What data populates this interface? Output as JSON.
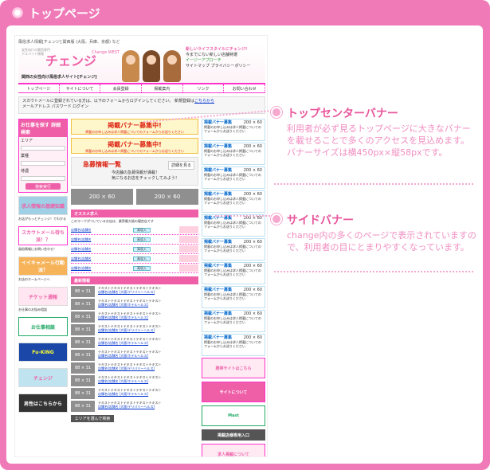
{
  "page_title": "トップページ",
  "shot": {
    "tagline": "風俗求人情報[チェンジ] 関西版 (大阪、兵庫、京都) など",
    "logo_sub": "女性向けの関西専門アルバイト情報",
    "logo": "チェンジ",
    "logo_west": "Change WEST",
    "logo_desc": "関西の女性向け風俗求人サイト[チェンジ]",
    "hdr_line1": "新しいライフスタイルにチェンジ!",
    "hdr_line2": "今までにない新しい店舗特選",
    "hdr_line3": "イージーアプローチ",
    "hdr_links": "サイトマップ  プライバシーポリシー",
    "nav": [
      "トップページ",
      "サイトについて",
      "会員登録",
      "掲載案内",
      "リンク",
      "お問い合わせ"
    ],
    "login_text": "スカウトメールに登録されている方は、以下のフォームからログインしてください。 新規登録は",
    "login_link": "こちらから",
    "login_fields": "メールアドレス  パスワード  ログイン",
    "left": {
      "search_title": "お仕事を探す 詳細検索",
      "search_labels": [
        "エリア",
        "業種",
        "待遇"
      ],
      "search_button": "検索実行",
      "banner1": "求人情報の基礎知識",
      "note1": "お店がもっとチェンジ！でわかる",
      "banner2": "スカウトメール待ち派！？",
      "note2": "風俗情報にお問い合わせ！",
      "banner3": "イイキャメール行動派？",
      "note3": "お店のホームページへ",
      "banner4": "チケット通報",
      "note4": "お仕事のお悩み相談",
      "banner5": "お仕事相談",
      "banner6": "Fu-KING",
      "banner7": "チェンジ",
      "banner8": "男性はこちらから"
    },
    "mid": {
      "top_banner1_title": "掲載バナー募集中!",
      "top_banner1_sub": "掲載のお申し込みは求人掲載についてのフォームからお送りください",
      "top_banner2_title": "掲載バナー募集中!",
      "top_banner2_sub": "掲載のお申し込みは求人掲載についてのフォームからお送りください",
      "kyubo_title": "急募情報一覧",
      "kyubo_detail": "詳細を見る",
      "kyubo_sub1": "今店舗の急募情報が満載！",
      "kyubo_sub2": "気になるお店をチェックしてみよう！",
      "ban200": [
        "200 × 60",
        "200 × 60"
      ],
      "recommend_title": "オススメ求人",
      "recommend_note": "このマークがついているお店は、業界最大級の優良店です",
      "rec_rows": [
        {
          "shop": "店舗名/店舗名",
          "badge": "高収入"
        },
        {
          "shop": "店舗名/店舗名",
          "badge": "高収入"
        },
        {
          "shop": "店舗名/店舗名",
          "badge": "高収入"
        },
        {
          "shop": "店舗名/店舗名",
          "badge": "高収入"
        },
        {
          "shop": "店舗名/店舗名",
          "badge": "高収入"
        }
      ],
      "new_title": "最新情報",
      "news": [
        {
          "tag": "88 × 31",
          "text": "テキストテキストテキストテキストテキスト",
          "link": "店舗名/店舗名 [大阪/デリバリーヘルス]"
        },
        {
          "tag": "88 × 31",
          "text": "テキストテキストテキストテキストテキスト",
          "link": "店舗名/店舗名 [大阪/ホテルヘルス]"
        },
        {
          "tag": "88 × 31",
          "text": "テキストテキストテキストテキストテキスト",
          "link": "店舗名/店舗名 [大阪/ホテルヘルス]"
        },
        {
          "tag": "88 × 31",
          "text": "テキストテキストテキストテキストテキスト",
          "link": "店舗名/店舗名 [大阪/デリバリーヘルス]"
        },
        {
          "tag": "88 × 31",
          "text": "テキストテキストテキストテキストテキスト",
          "link": "店舗名/店舗名 [大阪/ホテルヘルス]"
        },
        {
          "tag": "88 × 31",
          "text": "テキストテキストテキストテキストテキスト",
          "link": "店舗名/店舗名 [大阪/ホテルヘルス]"
        },
        {
          "tag": "88 × 31",
          "text": "テキストテキストテキストテキストテキスト",
          "link": "店舗名/店舗名 [大阪/デリバリーヘルス]"
        },
        {
          "tag": "88 × 31",
          "text": "テキストテキストテキストテキストテキスト",
          "link": "店舗名/店舗名 [大阪/ホテルヘルス]"
        },
        {
          "tag": "88 × 31",
          "text": "テキストテキストテキストテキストテキスト",
          "link": "店舗名/店舗名 [大阪/ホテルヘルス]"
        },
        {
          "tag": "88 × 31",
          "text": "テキストテキストテキストテキストテキスト",
          "link": "店舗名/店舗名 [大阪/デリバリーヘルス]"
        }
      ],
      "area_button": "エリアを選んで検索"
    },
    "right": {
      "side_banners": [
        {
          "title": "掲載バナー募集",
          "size": "200 × 60",
          "text": "掲載のお申し込みは求人掲載についてのフォームからお送りください"
        },
        {
          "title": "掲載バナー募集",
          "size": "200 × 60",
          "text": "掲載のお申し込みは求人掲載についてのフォームからお送りください"
        },
        {
          "title": "掲載バナー募集",
          "size": "200 × 60",
          "text": "掲載のお申し込みは求人掲載についてのフォームからお送りください"
        },
        {
          "title": "掲載バナー募集",
          "size": "200 × 60",
          "text": "掲載のお申し込みは求人掲載についてのフォームからお送りください"
        },
        {
          "title": "掲載バナー募集",
          "size": "200 × 60",
          "text": "掲載のお申し込みは求人掲載についてのフォームからお送りください"
        },
        {
          "title": "掲載バナー募集",
          "size": "200 × 60",
          "text": "掲載のお申し込みは求人掲載についてのフォームからお送りください"
        },
        {
          "title": "掲載バナー募集",
          "size": "200 × 60",
          "text": "掲載のお申し込みは求人掲載についてのフォームからお送りください"
        },
        {
          "title": "掲載バナー募集",
          "size": "200 × 60",
          "text": "掲載のお申し込みは求人掲載についてのフォームからお送りください"
        },
        {
          "title": "掲載バナー募集",
          "size": "200 × 60",
          "text": "掲載のお申し込みは求人掲載についてのフォームからお送りください"
        },
        {
          "title": "掲載バナー募集",
          "size": "200 × 60",
          "text": "掲載のお申し込みは求人掲載についてのフォームからお送りください"
        }
      ],
      "mobile_banner": "携帯サイトはこちら",
      "about_banner": "サイトについて",
      "mast_banner": "Mast",
      "login_button": "掲載店様専用入口",
      "recruit_banner": "求人掲載について"
    }
  },
  "callouts": [
    {
      "title": "トップセンターバナー",
      "body": "利用者が必ず見るトップページに大きなバナーを載せることで多くのアクセスを見込めます。\nバナーサイズは横450px×縦58pxです。"
    },
    {
      "title": "サイドバナー",
      "body": "change内の多くのページで表示されていますので、利用者の目にとまりやすくなっています。"
    }
  ],
  "colors": {
    "frame": "#f07ab8",
    "accent": "#e8579c",
    "callout_text": "#f08ec1"
  }
}
